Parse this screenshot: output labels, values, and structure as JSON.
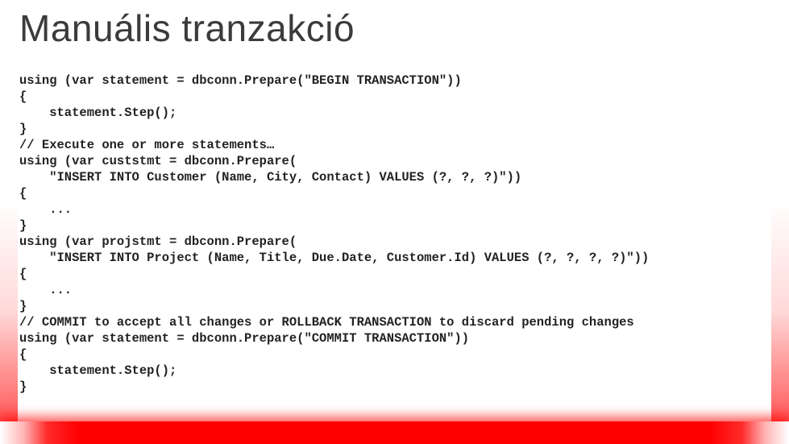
{
  "slide": {
    "title": "Manuális tranzakció",
    "code": {
      "l01": "using (var statement = dbconn.Prepare(\"BEGIN TRANSACTION\"))",
      "l02": "{",
      "l03": "    statement.Step();",
      "l04": "}",
      "l05": "// Execute one or more statements…",
      "l06": "using (var custstmt = dbconn.Prepare(",
      "l07": "    \"INSERT INTO Customer (Name, City, Contact) VALUES (?, ?, ?)\"))",
      "l08": "{",
      "l09": "    ...",
      "l10": "}",
      "l11": "using (var projstmt = dbconn.Prepare(",
      "l12": "    \"INSERT INTO Project (Name, Title, Due.Date, Customer.Id) VALUES (?, ?, ?, ?)\"))",
      "l13": "{",
      "l14": "    ...",
      "l15": "}",
      "l16": "// COMMIT to accept all changes or ROLLBACK TRANSACTION to discard pending changes",
      "l17": "using (var statement = dbconn.Prepare(\"COMMIT TRANSACTION\"))",
      "l18": "{",
      "l19": "    statement.Step();",
      "l20": "}"
    }
  }
}
